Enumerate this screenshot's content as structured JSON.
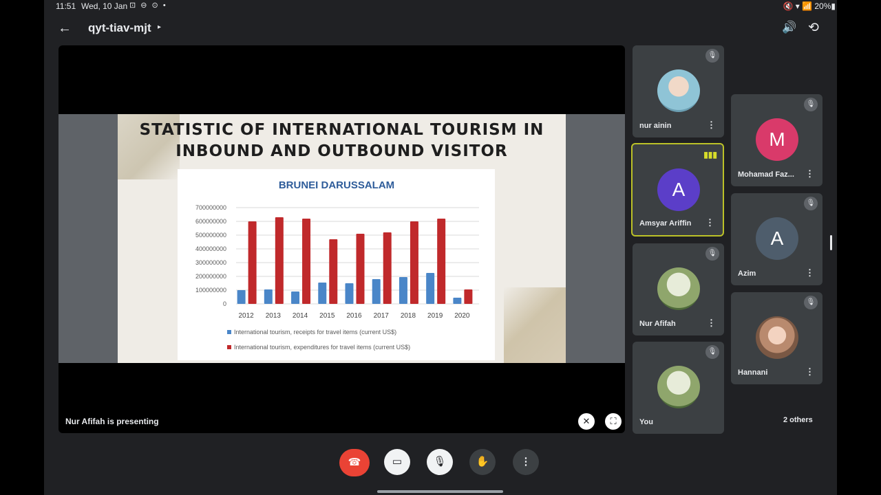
{
  "status_bar": {
    "time": "11:51",
    "date": "Wed, 10 Jan",
    "icons": "⊡ ⊖ ⊙ •",
    "battery": "🔇 ▾ 📶 20%▮"
  },
  "meeting": {
    "code": "qyt-tiav-mjt",
    "presenting_text": "Nur Afifah is presenting"
  },
  "colors": {
    "bg": "#202124",
    "tile": "#3c4043",
    "end_call": "#ea4335",
    "speaking": "#bcc227",
    "receipts": "#4a86c8",
    "expenditures": "#c0292b"
  },
  "slide": {
    "title_line1": "STATISTIC OF INTERNATIONAL TOURISM IN",
    "title_line2": "INBOUND AND OUTBOUND VISITOR"
  },
  "chart_data": {
    "type": "bar",
    "title": "BRUNEI DARUSSALAM",
    "categories": [
      "2012",
      "2013",
      "2014",
      "2015",
      "2016",
      "2017",
      "2018",
      "2019",
      "2020"
    ],
    "series": [
      {
        "name": "International tourism, receipts for travel items (current US$)",
        "values": [
          100000000,
          105000000,
          90000000,
          155000000,
          150000000,
          180000000,
          195000000,
          225000000,
          45000000
        ]
      },
      {
        "name": "International tourism, expenditures for travel items (current US$)",
        "values": [
          600000000,
          630000000,
          620000000,
          470000000,
          510000000,
          520000000,
          600000000,
          620000000,
          105000000
        ]
      }
    ],
    "yticks": [
      "0",
      "100000000",
      "200000000",
      "300000000",
      "400000000",
      "500000000",
      "600000000",
      "700000000"
    ],
    "ylim": [
      0,
      700000000
    ],
    "grid": true,
    "legend": "bottom"
  },
  "participants": [
    {
      "name": "nur ainin",
      "avatar": "photo",
      "muted": true
    },
    {
      "name": "Amsyar Ariffin",
      "avatar": "A",
      "avatar_color": "#5b3ec8",
      "speaking": true
    },
    {
      "name": "Nur Afifah",
      "avatar": "photo",
      "muted": true
    },
    {
      "name": "You",
      "avatar": "photo",
      "muted": true
    },
    {
      "name": "Mohamad Faz...",
      "avatar": "M",
      "avatar_color": "#d93a6a",
      "muted": true
    },
    {
      "name": "Azim",
      "avatar": "A",
      "avatar_color": "#4e5d6c",
      "muted": true
    },
    {
      "name": "Hannani",
      "avatar": "photo",
      "muted": true
    }
  ],
  "others_label": "2 others",
  "controls": {
    "end_call": "end-call",
    "camera": "camera-off",
    "mic": "mic-off",
    "hand": "raise-hand",
    "more": "more-options"
  },
  "glyphs": {
    "back": "←",
    "caret": "▸",
    "speaker": "🔊",
    "flip": "⟲",
    "mute": "🎙",
    "kebab": "⋮",
    "speaking": "▮▮▮",
    "pin": "✕",
    "fullscreen": "⛶",
    "end": "☎",
    "cam": "▭",
    "mic": "🎙",
    "hand": "✋",
    "more": "⋮"
  }
}
